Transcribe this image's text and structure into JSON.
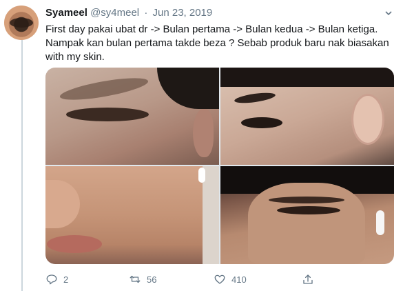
{
  "tweet": {
    "display_name": "Syameel",
    "handle": "@sy4meel",
    "separator": "·",
    "date": "Jun 23, 2019",
    "text_line1": "First day pakai ubat dr -> Bulan pertama -> Bulan kedua -> Bulan ketiga.",
    "text_line2": "Nampak kan bulan pertama takde beza ? Sebab produk baru nak biasakan",
    "text_line3": "with my skin."
  },
  "actions": {
    "reply_count": "2",
    "retweet_count": "56",
    "like_count": "410"
  },
  "icons": {
    "reply": "reply-icon",
    "retweet": "retweet-icon",
    "like": "heart-icon",
    "share": "share-icon",
    "more": "chevron-down-icon"
  },
  "colors": {
    "text": "#14171a",
    "secondary": "#657786",
    "thread_line": "#ccd6dd"
  }
}
